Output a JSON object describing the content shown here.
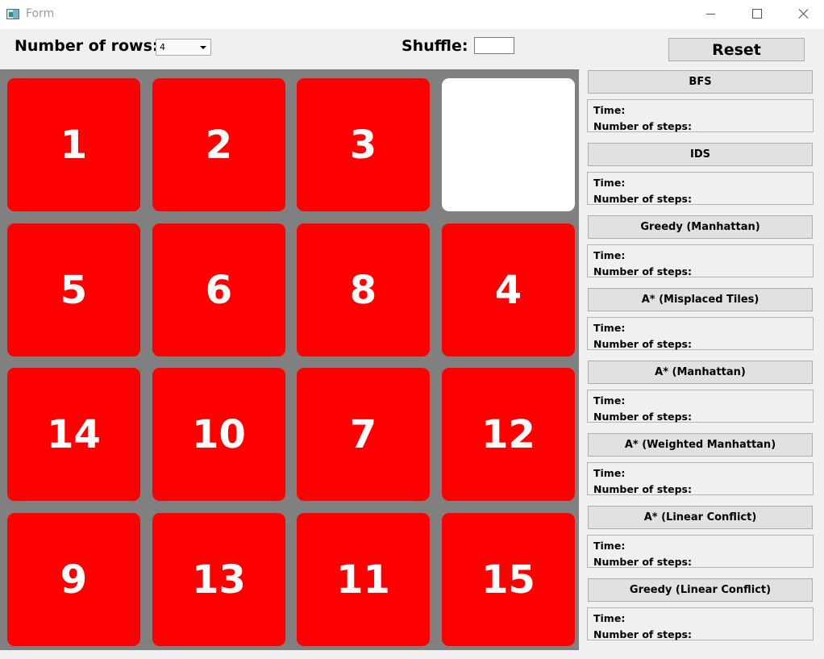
{
  "window": {
    "title": "Form",
    "controls": [
      "minimize-icon",
      "maximize-icon",
      "close-icon"
    ]
  },
  "controls": {
    "rows_label": "Number of rows:",
    "rows_value": "4",
    "shuffle_label": "Shuffle:",
    "shuffle_value": "",
    "reset_label": "Reset"
  },
  "board": {
    "rows": 4,
    "cols": 4,
    "tiles": [
      "1",
      "2",
      "3",
      "",
      "5",
      "6",
      "8",
      "4",
      "14",
      "10",
      "7",
      "12",
      "9",
      "13",
      "11",
      "15"
    ],
    "tile_color": "#ff0000",
    "blank_color": "#ffffff",
    "background_color": "#808080"
  },
  "algorithms": [
    {
      "name": "BFS",
      "time_label": "Time:",
      "steps_label": "Number of steps:"
    },
    {
      "name": "IDS",
      "time_label": "Time:",
      "steps_label": "Number of steps:"
    },
    {
      "name": "Greedy (Manhattan)",
      "time_label": "Time:",
      "steps_label": "Number of steps:"
    },
    {
      "name": "A* (Misplaced Tiles)",
      "time_label": "Time:",
      "steps_label": "Number of steps:"
    },
    {
      "name": "A* (Manhattan)",
      "time_label": "Time:",
      "steps_label": "Number of steps:"
    },
    {
      "name": "A* (Weighted Manhattan)",
      "time_label": "Time:",
      "steps_label": "Number of steps:"
    },
    {
      "name": "A* (Linear Conflict)",
      "time_label": "Time:",
      "steps_label": "Number of steps:"
    },
    {
      "name": "Greedy (Linear Conflict)",
      "time_label": "Time:",
      "steps_label": "Number of steps:"
    }
  ]
}
